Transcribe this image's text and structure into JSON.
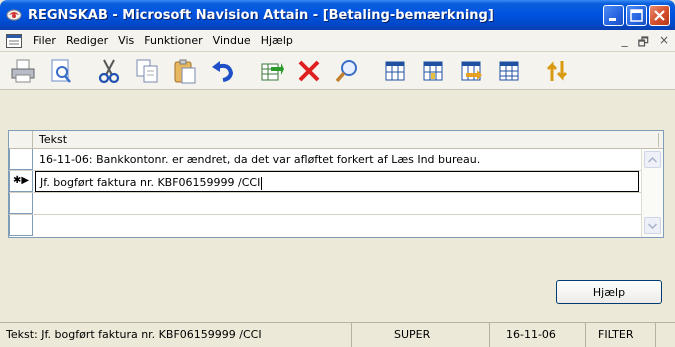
{
  "window": {
    "title": "REGNSKAB - Microsoft Navision Attain - [Betaling-bemærkning]",
    "app_icon": "navision-app-icon",
    "controls": {
      "minimize": "minimize-icon",
      "maximize": "maximize-icon",
      "close": "close-icon"
    }
  },
  "menu": {
    "items": [
      {
        "label": "Filer"
      },
      {
        "label": "Rediger"
      },
      {
        "label": "Vis"
      },
      {
        "label": "Funktioner"
      },
      {
        "label": "Vindue"
      },
      {
        "label": "Hjælp"
      }
    ],
    "doc_icon": "document-window-icon",
    "mdi_minimize": "_",
    "mdi_restore": "🗗",
    "mdi_close": "×"
  },
  "toolbar": {
    "buttons": [
      {
        "icon": "print-icon"
      },
      {
        "icon": "print-preview-icon"
      },
      {
        "icon": "cut-icon"
      },
      {
        "icon": "copy-icon"
      },
      {
        "icon": "paste-icon"
      },
      {
        "icon": "undo-icon"
      },
      {
        "icon": "new-record-icon"
      },
      {
        "icon": "delete-icon"
      },
      {
        "icon": "find-icon"
      },
      {
        "icon": "field-filter-icon"
      },
      {
        "icon": "table-filter-icon"
      },
      {
        "icon": "flow-filter-icon"
      },
      {
        "icon": "show-all-icon"
      },
      {
        "icon": "sort-icon"
      }
    ]
  },
  "grid": {
    "column_header": "Tekst",
    "rows": [
      {
        "text": "16-11-06: Bankkontonr. er ændret, da det var afløftet forkert af Læs Ind bureau.",
        "marker": ""
      },
      {
        "text": "Jf. bogført faktura nr. KBF06159999 /CCI",
        "marker": "✱▶"
      },
      {
        "text": "",
        "marker": ""
      },
      {
        "text": "",
        "marker": ""
      }
    ]
  },
  "buttons": {
    "help_label": "Hjælp"
  },
  "status": {
    "field_text": "Tekst: Jf. bogført faktura nr. KBF06159999 /CCI",
    "user": "SUPER",
    "work_date": "16-11-06",
    "filter": "FILTER"
  },
  "colors": {
    "titlebar": "#0054e3",
    "window_bg": "#ece9d8",
    "grid_border": "#7f9db9",
    "delete_red": "#e02020"
  }
}
